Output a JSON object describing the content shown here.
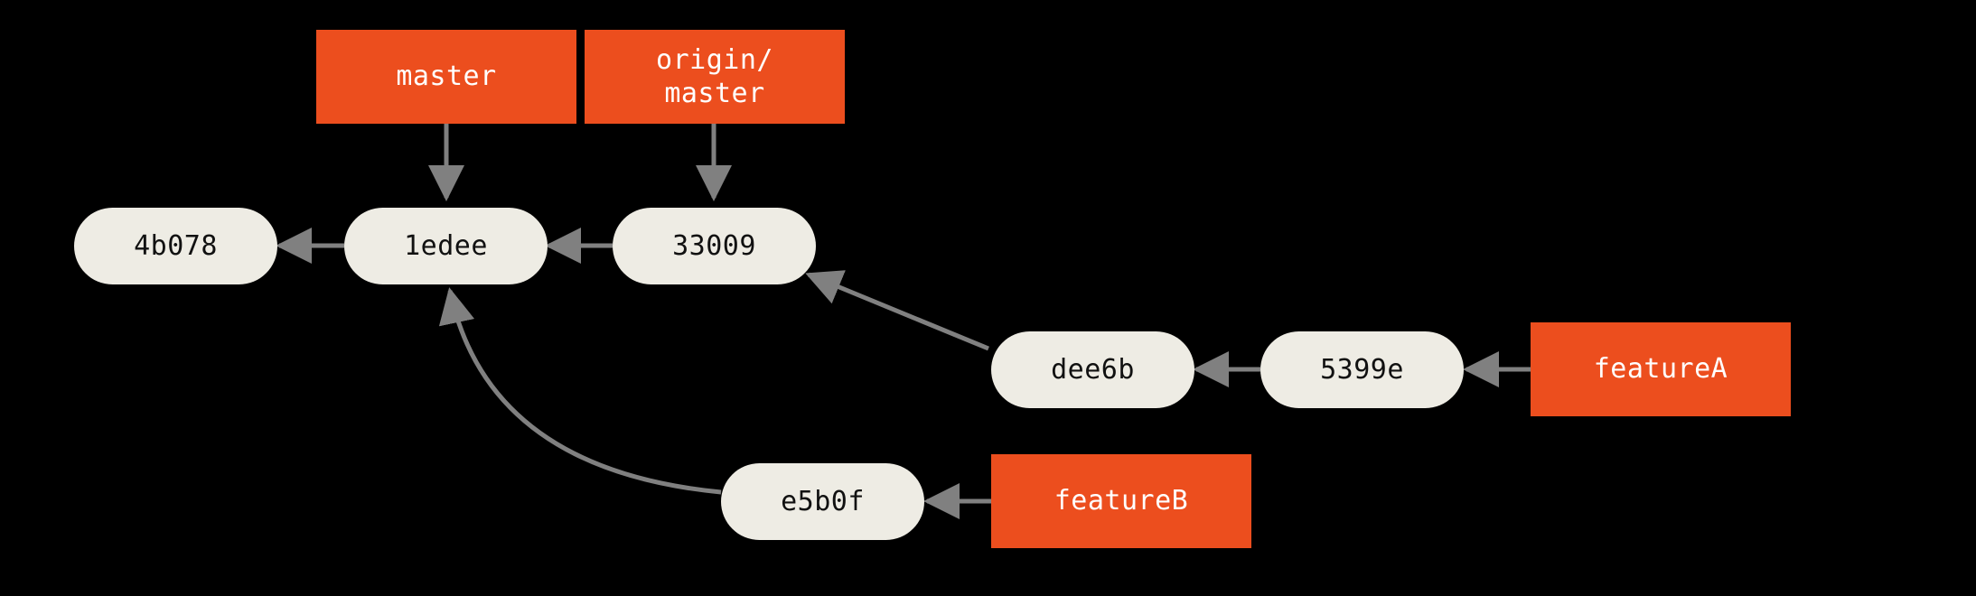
{
  "diagram": {
    "commits": {
      "c1": {
        "hash": "4b078"
      },
      "c2": {
        "hash": "1edee"
      },
      "c3": {
        "hash": "33009"
      },
      "c4": {
        "hash": "dee6b"
      },
      "c5": {
        "hash": "5399e"
      },
      "c6": {
        "hash": "e5b0f"
      }
    },
    "branches": {
      "master": {
        "label": "master"
      },
      "origin_master": {
        "label": "origin/\nmaster"
      },
      "featureA": {
        "label": "featureA"
      },
      "featureB": {
        "label": "featureB"
      }
    },
    "edges": [
      {
        "from": "c2",
        "to": "c1",
        "type": "parent"
      },
      {
        "from": "c3",
        "to": "c2",
        "type": "parent"
      },
      {
        "from": "c4",
        "to": "c3",
        "type": "parent"
      },
      {
        "from": "c5",
        "to": "c4",
        "type": "parent"
      },
      {
        "from": "c6",
        "to": "c2",
        "type": "parent"
      },
      {
        "from": "master",
        "to": "c2",
        "type": "ref"
      },
      {
        "from": "origin_master",
        "to": "c3",
        "type": "ref"
      },
      {
        "from": "featureA",
        "to": "c5",
        "type": "ref"
      },
      {
        "from": "featureB",
        "to": "c6",
        "type": "ref"
      }
    ],
    "colors": {
      "commit_bg": "#EEECE4",
      "branch_bg": "#EC4E1E",
      "edge": "#808080",
      "background": "#000000"
    }
  }
}
